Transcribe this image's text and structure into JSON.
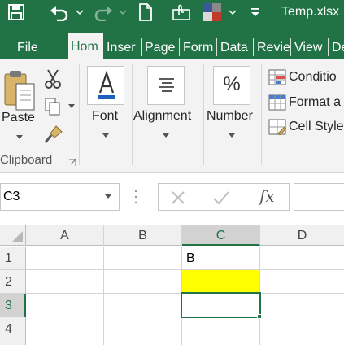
{
  "window": {
    "title": "Temp.xlsx"
  },
  "quick_access": {
    "icons": [
      "save-icon",
      "undo-icon",
      "redo-icon",
      "new-document-icon",
      "touch-mode-icon",
      "theme-colors-icon",
      "customize-icon"
    ]
  },
  "ribbon_tabs": [
    {
      "label": "File"
    },
    {
      "label": "Hom"
    },
    {
      "label": "Inser"
    },
    {
      "label": "Page"
    },
    {
      "label": "Form"
    },
    {
      "label": "Data"
    },
    {
      "label": "Revie"
    },
    {
      "label": "View"
    },
    {
      "label": "De"
    }
  ],
  "active_tab": "Hom",
  "ribbon": {
    "clipboard": {
      "paste": "Paste",
      "group_label": "Clipboard"
    },
    "font": {
      "label": "Font"
    },
    "alignment": {
      "label": "Alignment"
    },
    "number": {
      "label": "Number",
      "symbol": "%"
    },
    "styles": {
      "conditional": "Conditio",
      "format_as": "Format a",
      "cell_styles": "Cell Style"
    }
  },
  "formula_bar": {
    "name_box": "C3",
    "fx_label": "fx",
    "value": ""
  },
  "columns": [
    "A",
    "B",
    "C",
    "D"
  ],
  "rows": [
    "1",
    "2",
    "3",
    "4"
  ],
  "cells": {
    "C1": "B"
  },
  "selected_cell": "C3",
  "colors": {
    "accent": "#217346",
    "highlight_fill": "#FFFF00",
    "sheet_text": "#000000"
  }
}
